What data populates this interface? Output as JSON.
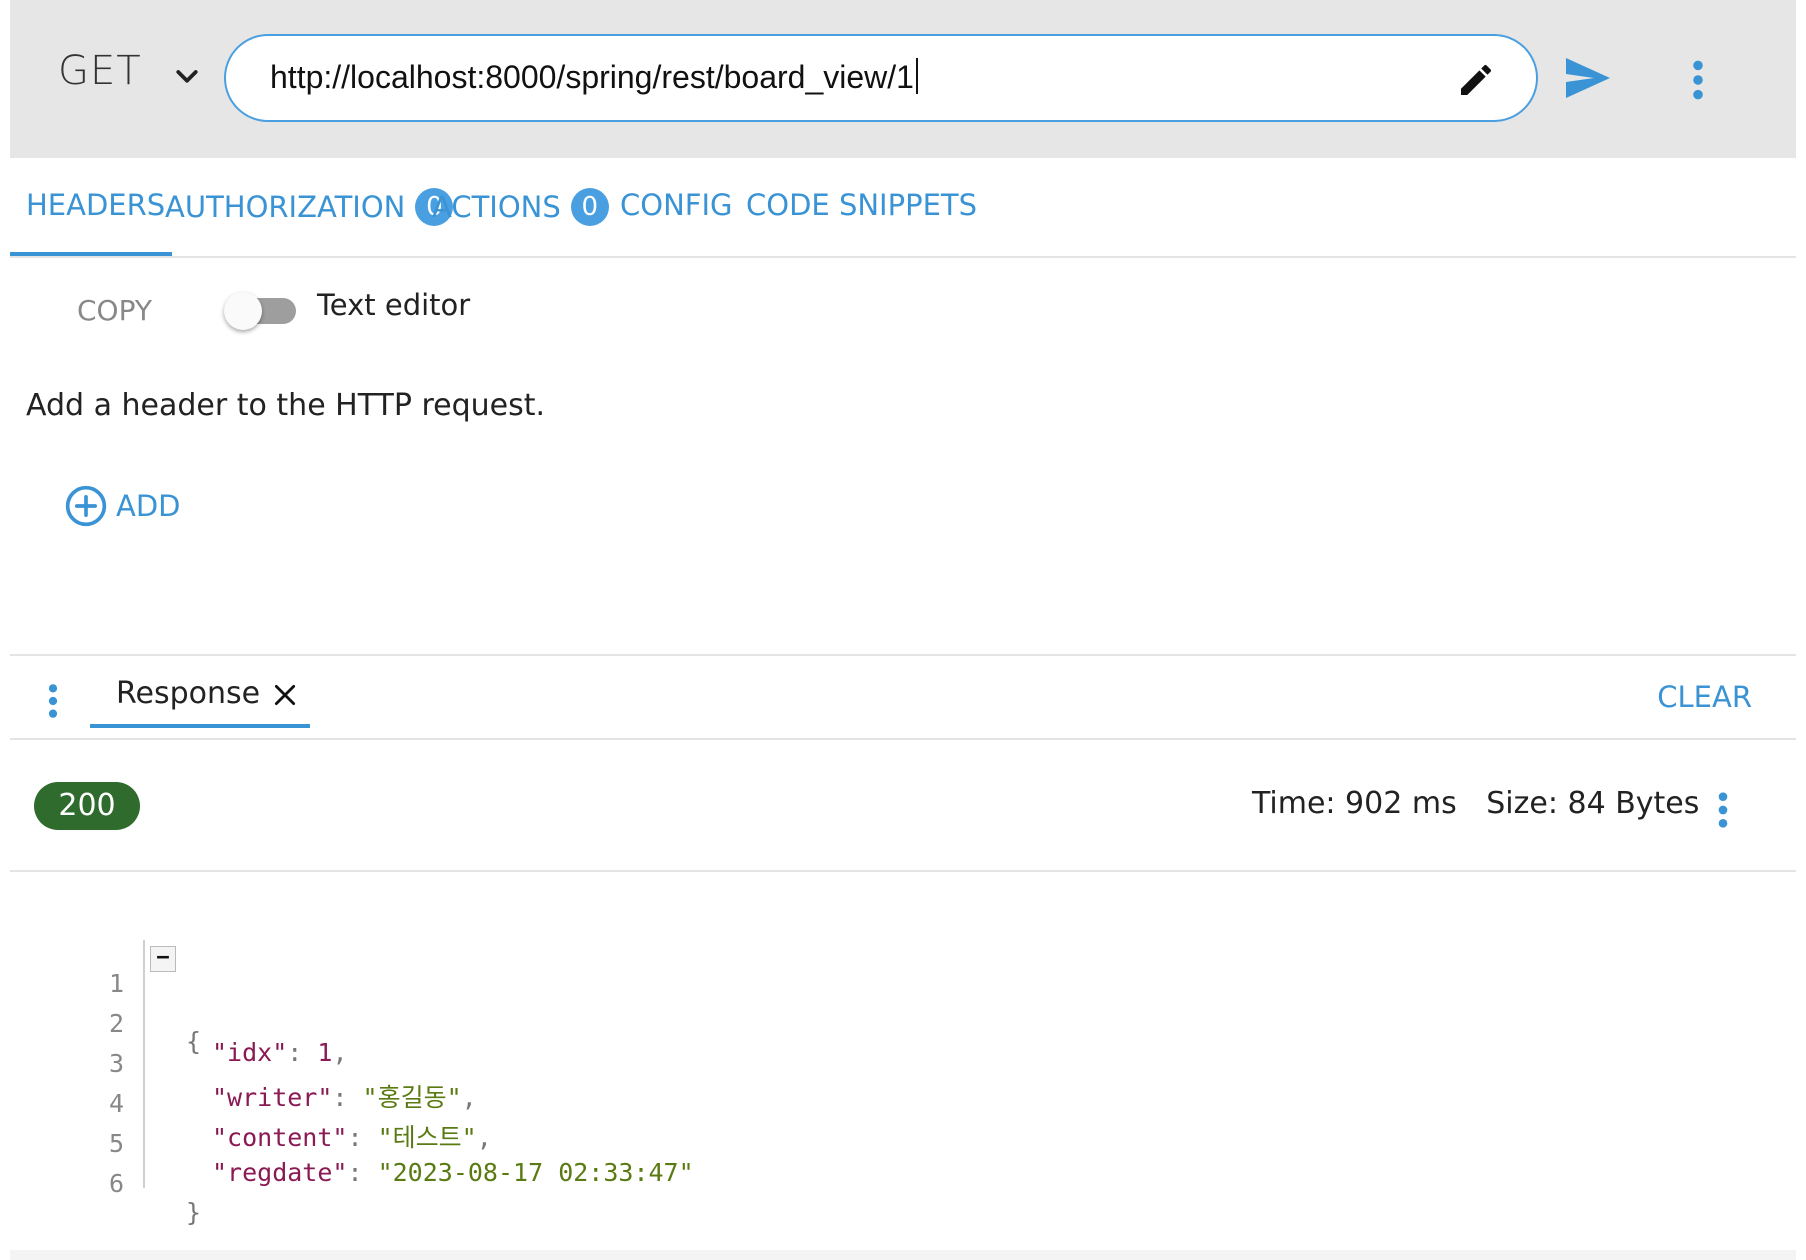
{
  "request": {
    "method": "GET",
    "url": "http://localhost:8000/spring/rest/board_view/1"
  },
  "tabs": [
    {
      "label": "HEADERS",
      "count": null
    },
    {
      "label": "AUTHORIZATION",
      "count": "0"
    },
    {
      "label": "ACTIONS",
      "count": "0"
    },
    {
      "label": "CONFIG",
      "count": null
    },
    {
      "label": "CODE SNIPPETS",
      "count": null
    }
  ],
  "headers_panel": {
    "copy_label": "COPY",
    "toggle_label": "Text editor",
    "toggle_on": false,
    "hint": "Add a header to the HTTP request.",
    "add_label": "ADD"
  },
  "response": {
    "tab_label": "Response",
    "clear_label": "CLEAR",
    "status": "200",
    "time": "Time: 902 ms",
    "size": "Size: 84 Bytes"
  },
  "code": {
    "line_numbers": [
      "1",
      "2",
      "3",
      "4",
      "5",
      "6"
    ],
    "fold_marker": "−",
    "lines": [
      {
        "open": "{"
      },
      {
        "key": "\"idx\"",
        "colon": ": ",
        "value": "1",
        "comma": ","
      },
      {
        "key": "\"writer\"",
        "colon": ": ",
        "value": "\"홍길동\"",
        "comma": ","
      },
      {
        "key": "\"content\"",
        "colon": ": ",
        "value": "\"테스트\"",
        "comma": ","
      },
      {
        "key": "\"regdate\"",
        "colon": ": ",
        "value": "\"2023-08-17 02:33:47\"",
        "comma": ""
      },
      {
        "close": "}"
      }
    ]
  },
  "colors": {
    "accent": "#3a93d4",
    "status_ok": "#2e6b2c",
    "json_key": "#8a1a53",
    "json_string": "#5a7a12"
  },
  "icons": [
    "chevron-down-icon",
    "edit-pencil-icon",
    "send-icon",
    "more-vert-icon",
    "add-circle-icon",
    "close-icon"
  ]
}
